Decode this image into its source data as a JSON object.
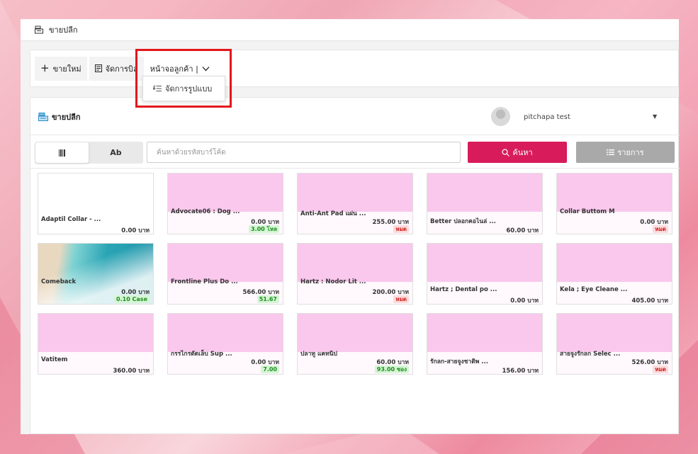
{
  "window": {
    "title": "ขายปลีก"
  },
  "toolbar": {
    "new_sale": "ขายใหม่",
    "manage_bill": "จัดการบิล",
    "customer_screen": "หน้าจอลูกค้า |",
    "dropdown_item": "จัดการรูปแบบ"
  },
  "panel": {
    "title": "ขายปลีก",
    "user": "pitchapa test"
  },
  "search": {
    "barcode_tab": "|||",
    "ab_tab": "Ab",
    "placeholder": "ค้นหาด้วยรหัสบาร์โค้ด",
    "search_btn": "ค้นหา",
    "list_btn": "รายการ"
  },
  "products": [
    {
      "name": "Adaptil Collar - ...",
      "price": "0.00 บาท",
      "badge": "",
      "badge_color": "",
      "image": "none"
    },
    {
      "name": "Advocate06 : Dog ...",
      "price": "0.00 บาท",
      "badge": "3.00 โหล",
      "badge_color": "green",
      "image": "pink"
    },
    {
      "name": "Anti-Ant Pad แผ่น ...",
      "price": "255.00 บาท",
      "badge": "หมด",
      "badge_color": "red",
      "image": "pink"
    },
    {
      "name": "Better ปลอกคอไนล่ ...",
      "price": "60.00 บาท",
      "badge": "",
      "badge_color": "",
      "image": "pink"
    },
    {
      "name": "Collar Buttom M",
      "price": "0.00 บาท",
      "badge": "หมด",
      "badge_color": "red",
      "image": "pink"
    },
    {
      "name": "Comeback",
      "price": "0.00 บาท",
      "badge": "0.10 Case",
      "badge_color": "green",
      "image": "beach"
    },
    {
      "name": "Frontline Plus Do ...",
      "price": "566.00 บาท",
      "badge": "51.67",
      "badge_color": "green",
      "image": "pink"
    },
    {
      "name": "Hartz : Nodor Lit ...",
      "price": "200.00 บาท",
      "badge": "หมด",
      "badge_color": "red",
      "image": "pink"
    },
    {
      "name": "Hartz ; Dental po ...",
      "price": "0.00 บาท",
      "badge": "",
      "badge_color": "",
      "image": "pink"
    },
    {
      "name": "Kela ; Eye Cleane ...",
      "price": "405.00 บาท",
      "badge": "",
      "badge_color": "",
      "image": "pink"
    },
    {
      "name": "Vatitem",
      "price": "360.00 บาท",
      "badge": "",
      "badge_color": "",
      "image": "pink"
    },
    {
      "name": "กรรไกรตัดเล็บ Sup ...",
      "price": "0.00 บาท",
      "badge": "7.00",
      "badge_color": "green",
      "image": "pink"
    },
    {
      "name": "ปลาทู แคทนิป",
      "price": "60.00 บาท",
      "badge": "93.00 ซอง",
      "badge_color": "green",
      "image": "pink"
    },
    {
      "name": "รักลก-สายจูงชาติพ ...",
      "price": "156.00 บาท",
      "badge": "",
      "badge_color": "",
      "image": "pink"
    },
    {
      "name": "สายจูงรักลก Selec ...",
      "price": "526.00 บาท",
      "badge": "หมด",
      "badge_color": "red",
      "image": "pink"
    }
  ],
  "colors": {
    "accent": "#d81b5a",
    "highlight": "#e3161b",
    "card_pink": "#f9c8ec"
  }
}
